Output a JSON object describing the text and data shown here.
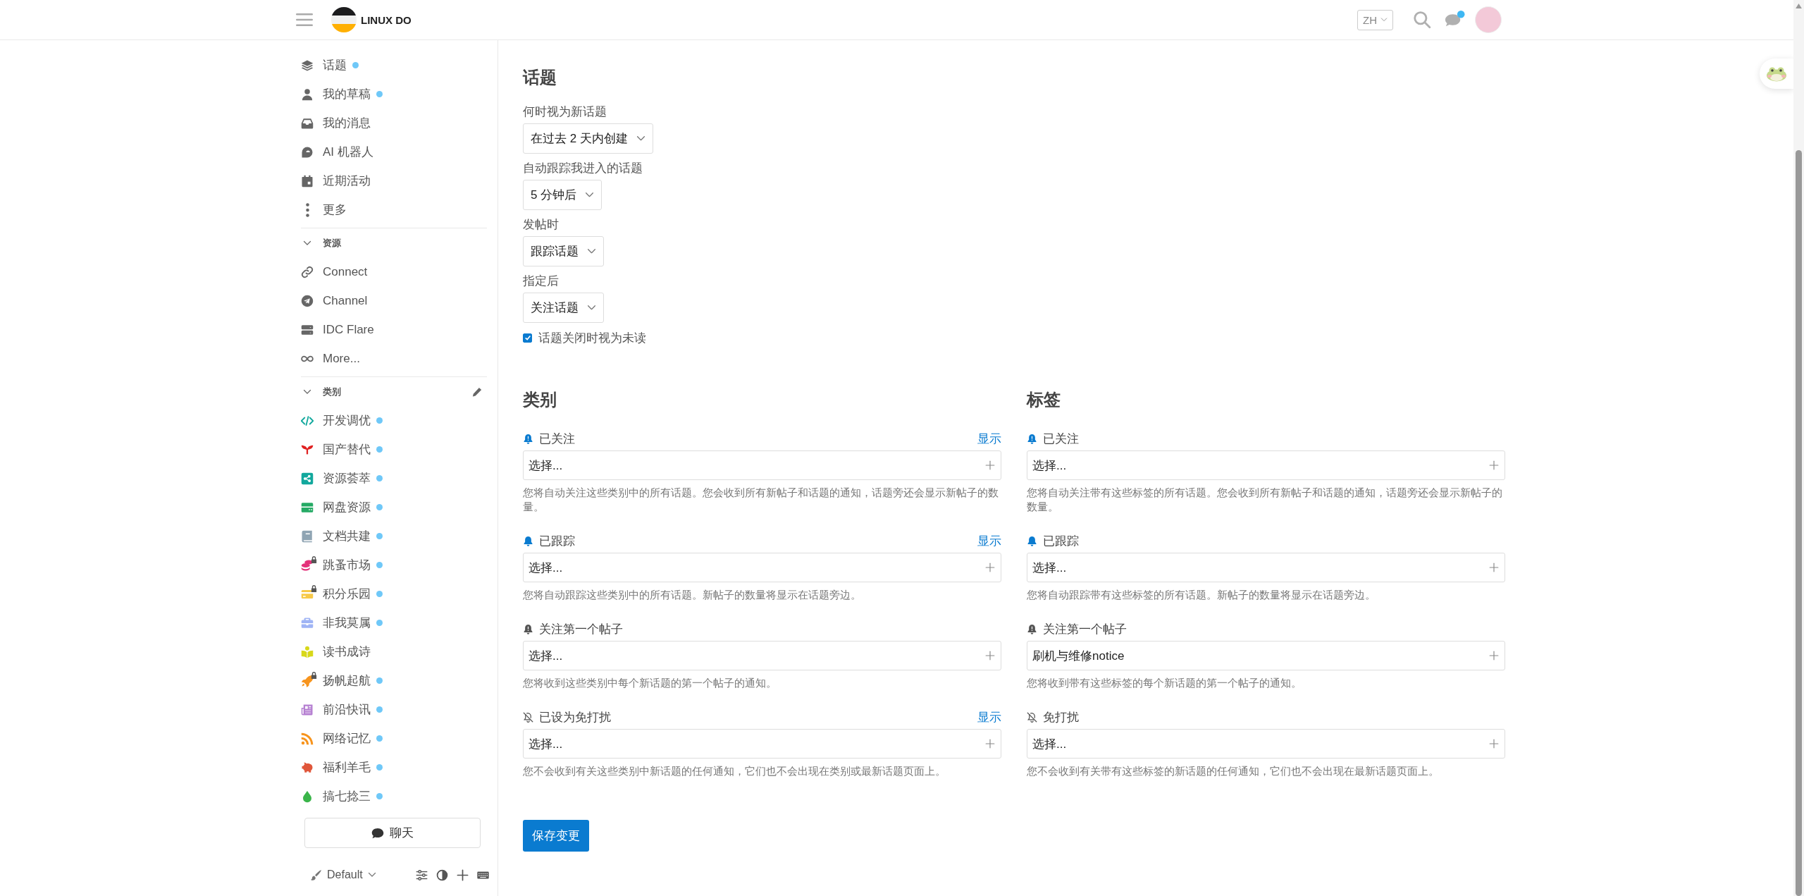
{
  "header": {
    "site_name": "LINUX DO",
    "language": "ZH",
    "chat_unread": true
  },
  "sidebar": {
    "items": [
      {
        "label": "话题",
        "unread": true
      },
      {
        "label": "我的草稿",
        "unread": true
      },
      {
        "label": "我的消息",
        "unread": false
      },
      {
        "label": "AI 机器人",
        "unread": false
      },
      {
        "label": "近期活动",
        "unread": false
      },
      {
        "label": "更多",
        "unread": false
      }
    ],
    "sections": [
      {
        "title": "资源",
        "expanded": true,
        "editable": false,
        "items": [
          {
            "label": "Connect"
          },
          {
            "label": "Channel"
          },
          {
            "label": "IDC Flare"
          },
          {
            "label": "More..."
          }
        ]
      },
      {
        "title": "类别",
        "expanded": true,
        "editable": true,
        "items": [
          {
            "label": "开发调优",
            "color": "#12a89d",
            "unread": true,
            "locked": false
          },
          {
            "label": "国产替代",
            "color": "#e02020",
            "unread": true,
            "locked": false
          },
          {
            "label": "资源荟萃",
            "color": "#12a89d",
            "unread": true,
            "locked": false
          },
          {
            "label": "网盘资源",
            "color": "#25aa65",
            "unread": true,
            "locked": false
          },
          {
            "label": "文档共建",
            "color": "#8fa4b3",
            "unread": true,
            "locked": false
          },
          {
            "label": "跳蚤市场",
            "color": "#e3317a",
            "unread": true,
            "locked": true
          },
          {
            "label": "积分乐园",
            "color": "#f7c948",
            "unread": true,
            "locked": true
          },
          {
            "label": "非我莫属",
            "color": "#9fb4f5",
            "unread": true,
            "locked": false
          },
          {
            "label": "读书成诗",
            "color": "#d8d81a",
            "unread": false,
            "locked": false
          },
          {
            "label": "扬帆起航",
            "color": "#f7941d",
            "unread": true,
            "locked": true
          },
          {
            "label": "前沿快讯",
            "color": "#b57fd1",
            "unread": true,
            "locked": false
          },
          {
            "label": "网络记忆",
            "color": "#f7941d",
            "unread": true,
            "locked": false
          },
          {
            "label": "福利羊毛",
            "color": "#e0563a",
            "unread": true,
            "locked": false
          },
          {
            "label": "搞七捻三",
            "color": "#3ab54a",
            "unread": true,
            "locked": false
          }
        ]
      }
    ],
    "chat_button": "聊天",
    "theme": "Default"
  },
  "topics": {
    "title": "话题",
    "settings": [
      {
        "label": "何时视为新话题",
        "value": "在过去 2 天内创建"
      },
      {
        "label": "自动跟踪我进入的话题",
        "value": "5 分钟后"
      },
      {
        "label": "发帖时",
        "value": "跟踪话题"
      },
      {
        "label": "指定后",
        "value": "关注话题"
      }
    ],
    "option": {
      "label": "话题关闭时视为未读",
      "checked": true
    }
  },
  "notification_columns": [
    {
      "title": "类别",
      "groups": [
        {
          "kind": "watching",
          "label": "已关注",
          "link": "显示",
          "placeholder": "选择...",
          "help": "您将自动关注这些类别中的所有话题。您会收到所有新帖子和话题的通知，话题旁还会显示新帖子的数量。"
        },
        {
          "kind": "tracking",
          "label": "已跟踪",
          "link": "显示",
          "placeholder": "选择...",
          "help": "您将自动跟踪这些类别中的所有话题。新帖子的数量将显示在话题旁边。"
        },
        {
          "kind": "watching_first",
          "label": "关注第一个帖子",
          "placeholder": "选择...",
          "help": "您将收到这些类别中每个新话题的第一个帖子的通知。"
        },
        {
          "kind": "muted",
          "label": "已设为免打扰",
          "link": "显示",
          "placeholder": "选择...",
          "help": "您不会收到有关这些类别中新话题的任何通知，它们也不会出现在类别或最新话题页面上。"
        }
      ]
    },
    {
      "title": "标签",
      "groups": [
        {
          "kind": "watching",
          "label": "已关注",
          "placeholder": "选择...",
          "help": "您将自动关注带有这些标签的所有话题。您会收到所有新帖子和话题的通知，话题旁还会显示新帖子的数量。"
        },
        {
          "kind": "tracking",
          "label": "已跟踪",
          "placeholder": "选择...",
          "help": "您将自动跟踪带有这些标签的所有话题。新帖子的数量将显示在话题旁边。"
        },
        {
          "kind": "watching_first",
          "label": "关注第一个帖子",
          "value": "刷机与维修notice",
          "help": "您将收到带有这些标签的每个新话题的第一个帖子的通知。"
        },
        {
          "kind": "muted",
          "label": "免打扰",
          "placeholder": "选择...",
          "help": "您不会收到有关带有这些标签的新话题的任何通知，它们也不会出现在最新话题页面上。"
        }
      ]
    }
  ],
  "save_button": "保存变更"
}
